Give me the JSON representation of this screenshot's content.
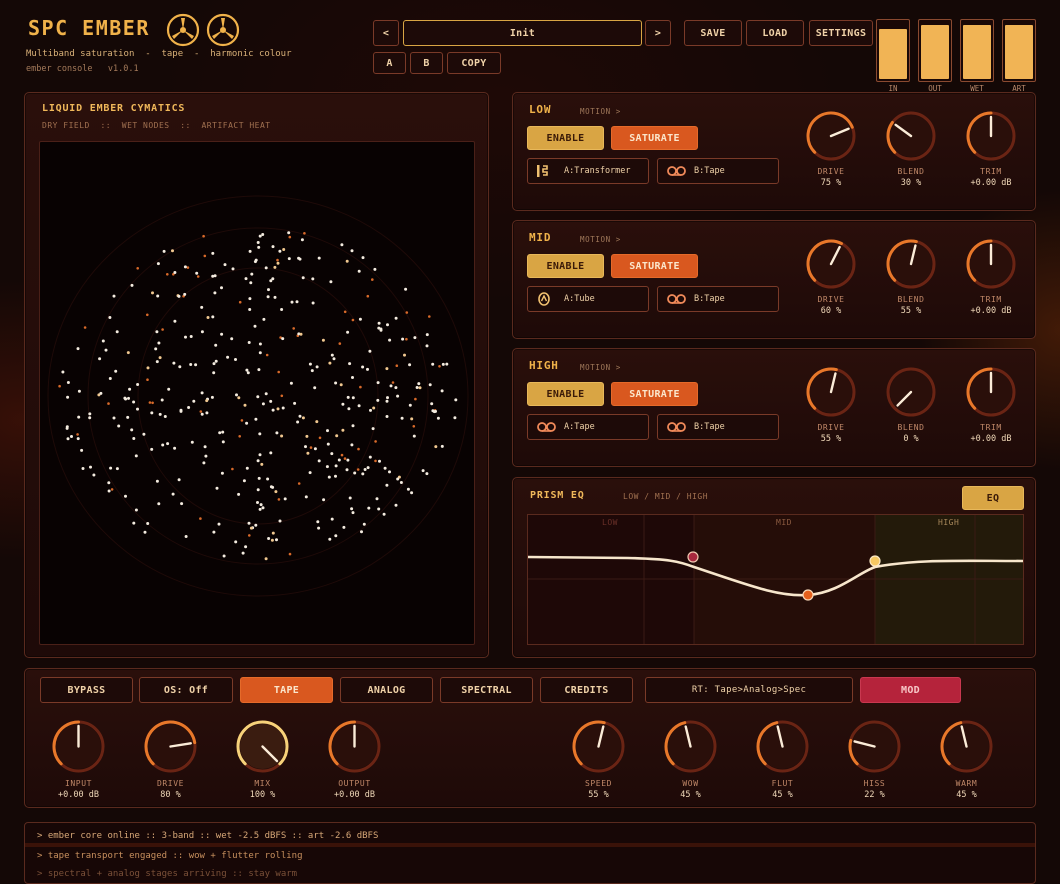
{
  "header": {
    "title": "SPC EMBER",
    "tagline": "Multiband saturation  -  tape  -  harmonic colour",
    "version_line": "ember console   v1.0.1"
  },
  "preset": {
    "prev_label": "<",
    "name": "Init",
    "next_label": ">",
    "a_label": "A",
    "b_label": "B",
    "copy_label": "COPY"
  },
  "toolbar": {
    "save_label": "SAVE",
    "load_label": "LOAD",
    "settings_label": "SETTINGS"
  },
  "meters": [
    {
      "label": "IN",
      "level": 0.85
    },
    {
      "label": "OUT",
      "level": 0.92
    },
    {
      "label": "WET",
      "level": 0.92
    },
    {
      "label": "ART",
      "level": 0.92
    }
  ],
  "cymatics": {
    "title": "LIQUID EMBER CYMATICS",
    "subtitle": "DRY FIELD  ::  WET NODES  ::  ARTIFACT HEAT"
  },
  "bands": [
    {
      "name": "LOW",
      "motion": "MOTION >",
      "enable_label": "ENABLE",
      "saturate_label": "SATURATE",
      "algo_a": "A:Transformer",
      "algo_a_icon": "transformer-icon",
      "algo_b": "B:Tape",
      "algo_b_icon": "tape-icon",
      "knobs": [
        {
          "label": "DRIVE",
          "value": "75 %",
          "amount": 0.75
        },
        {
          "label": "BLEND",
          "value": "30 %",
          "amount": 0.3
        },
        {
          "label": "TRIM",
          "value": "+0.00 dB",
          "amount": 0.5
        }
      ]
    },
    {
      "name": "MID",
      "motion": "MOTION >",
      "enable_label": "ENABLE",
      "saturate_label": "SATURATE",
      "algo_a": "A:Tube",
      "algo_a_icon": "tube-icon",
      "algo_b": "B:Tape",
      "algo_b_icon": "tape-icon",
      "knobs": [
        {
          "label": "DRIVE",
          "value": "60 %",
          "amount": 0.6
        },
        {
          "label": "BLEND",
          "value": "55 %",
          "amount": 0.55
        },
        {
          "label": "TRIM",
          "value": "+0.00 dB",
          "amount": 0.5
        }
      ]
    },
    {
      "name": "HIGH",
      "motion": "MOTION >",
      "enable_label": "ENABLE",
      "saturate_label": "SATURATE",
      "algo_a": "A:Tape",
      "algo_a_icon": "tape-icon",
      "algo_b": "B:Tape",
      "algo_b_icon": "tape-icon",
      "knobs": [
        {
          "label": "DRIVE",
          "value": "55 %",
          "amount": 0.55
        },
        {
          "label": "BLEND",
          "value": "0 %",
          "amount": 0.0
        },
        {
          "label": "TRIM",
          "value": "+0.00 dB",
          "amount": 0.5
        }
      ]
    }
  ],
  "eq": {
    "title": "PRISM EQ",
    "subtitle": "LOW / MID / HIGH",
    "button_label": "EQ",
    "regions": [
      "LOW",
      "MID",
      "HIGH"
    ]
  },
  "bottom": {
    "bypass_label": "BYPASS",
    "os_label": "OS: Off",
    "tape_label": "TAPE",
    "analog_label": "ANALOG",
    "spectral_label": "SPECTRAL",
    "credits_label": "CREDITS",
    "route_label": "RT: Tape>Analog>Spec",
    "mod_label": "MOD",
    "knobs_left": [
      {
        "label": "INPUT",
        "value": "+0.00 dB",
        "amount": 0.5
      },
      {
        "label": "DRIVE",
        "value": "80 %",
        "amount": 0.8
      },
      {
        "label": "MIX",
        "value": "100 %",
        "amount": 1.0
      },
      {
        "label": "OUTPUT",
        "value": "+0.00 dB",
        "amount": 0.5
      }
    ],
    "knobs_right": [
      {
        "label": "SPEED",
        "value": "55 %",
        "amount": 0.55
      },
      {
        "label": "WOW",
        "value": "45 %",
        "amount": 0.45
      },
      {
        "label": "FLUT",
        "value": "45 %",
        "amount": 0.45
      },
      {
        "label": "HISS",
        "value": "22 %",
        "amount": 0.22
      },
      {
        "label": "WARM",
        "value": "45 %",
        "amount": 0.45
      }
    ]
  },
  "log": [
    "> ember core online :: 3-band :: wet -2.5 dBFS :: art -2.6 dBFS",
    "> tape transport engaged :: wow + flutter rolling",
    "> spectral + analog stages arriving :: stay warm"
  ],
  "colors": {
    "accent_gold": "#f0b24a",
    "saturate_orange": "#d9581f",
    "mod_crimson": "#b5233b",
    "meter_fill": "#f1b455"
  }
}
